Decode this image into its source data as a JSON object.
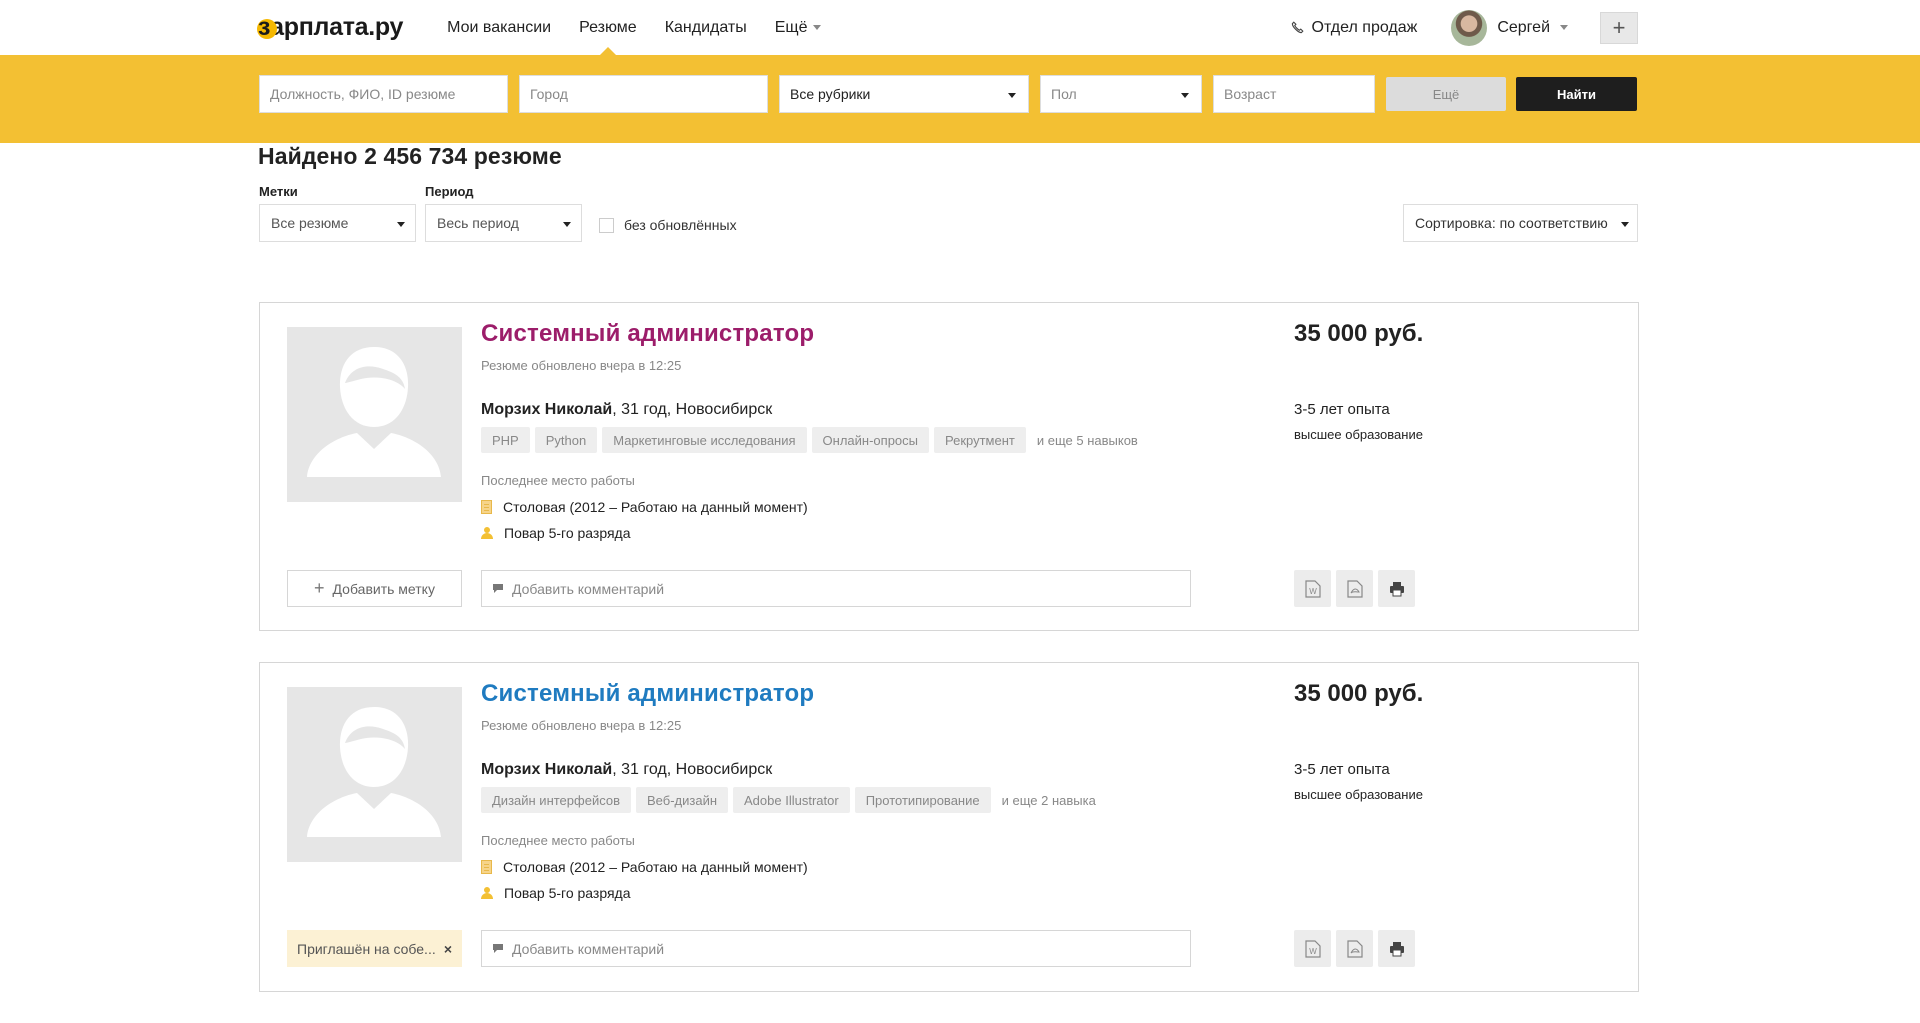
{
  "header": {
    "logo_first": "з",
    "logo_rest": "арплата.ру",
    "nav": [
      {
        "label": "Мои вакансии"
      },
      {
        "label": "Резюме"
      },
      {
        "label": "Кандидаты"
      },
      {
        "label": "Ещё"
      }
    ],
    "sales_label": "Отдел продаж",
    "user_name": "Сергей",
    "plus_label": "+",
    "active_nav": "Резюме"
  },
  "search": {
    "query_placeholder": "Должность, ФИО, ID резюме",
    "city_placeholder": "Город",
    "rubric_value": "Все рубрики",
    "gender_value": "Пол",
    "age_placeholder": "Возраст",
    "more_label": "Ещё",
    "find_label": "Найти"
  },
  "results": {
    "title": "Найдено 2 456 734 резюме",
    "tags_label": "Метки",
    "tags_value": "Все резюме",
    "period_label": "Период",
    "period_value": "Весь период",
    "no_updated_label": "без обновлённых",
    "sort_value": "Сортировка: по соответствию"
  },
  "cards": [
    {
      "title": "Системный администратор",
      "updated": "Резюме обновлено вчера в 12:25",
      "name": "Морзих Николай",
      "details": ", 31 год, Новосибирск",
      "skills": [
        "PHP",
        "Python",
        "Маркетинговые исследования",
        "Онлайн-опросы",
        "Рекрутмент"
      ],
      "more_skills": "и еще 5 навыков",
      "last_work_label": "Последнее место работы",
      "company": "Столовая (2012 – Работаю на данный момент)",
      "position": "Повар 5-го разряда",
      "salary": "35 000 руб.",
      "experience": "3-5 лет опыта",
      "education": "высшее образование",
      "add_tag_label": "Добавить метку",
      "comment_placeholder": "Добавить комментарий"
    },
    {
      "title": "Системный администратор",
      "updated": "Резюме обновлено вчера в 12:25",
      "name": "Морзих Николай",
      "details": ", 31 год, Новосибирск",
      "skills": [
        "Дизайн интерфейсов",
        "Веб-дизайн",
        "Adobe Illustrator",
        "Прототипирование"
      ],
      "more_skills": "и еще 2 навыка",
      "last_work_label": "Последнее место работы",
      "company": "Столовая (2012 – Работаю на данный момент)",
      "position": "Повар 5-го разряда",
      "salary": "35 000 руб.",
      "experience": "3-5 лет опыта",
      "education": "высшее образование",
      "invite_tag_label": "Приглашён на собе...",
      "invite_remove": "×",
      "comment_placeholder": "Добавить комментарий"
    }
  ],
  "colors": {
    "accent_yellow": "#f3c033",
    "visited_title": "#9c1d6a",
    "link_title": "#1f7bc0",
    "find_button": "#1e1e1e"
  },
  "icons": [
    "phone-icon",
    "avatar",
    "chevron-down-icon",
    "plus-icon",
    "comment-icon",
    "word-icon",
    "pdf-icon",
    "print-icon",
    "building-icon",
    "person-icon",
    "user-placeholder-icon"
  ]
}
